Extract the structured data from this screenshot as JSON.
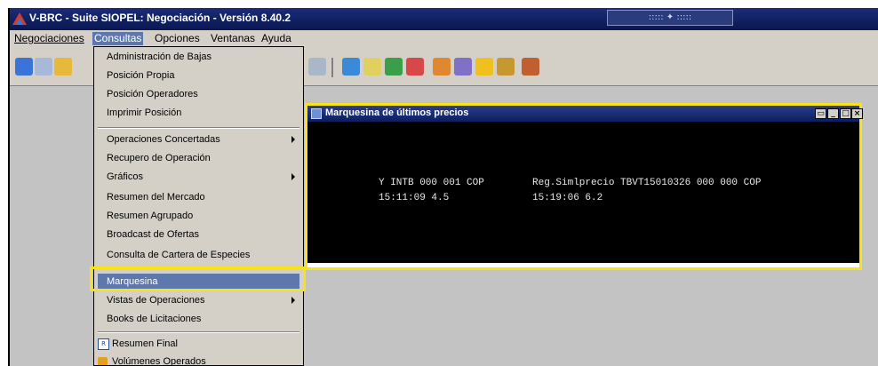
{
  "app": {
    "title": "V-BRC - Suite SIOPEL: Negociación - Versión 8.40.2"
  },
  "menubar": {
    "items": [
      {
        "label": "Negociaciones"
      },
      {
        "label": "Consultas"
      },
      {
        "label": "Opciones"
      },
      {
        "label": "Ventanas"
      },
      {
        "label": "Ayuda"
      }
    ]
  },
  "dropdown": {
    "items": [
      {
        "label": "Administración de Bajas"
      },
      {
        "label": "Posición Propia"
      },
      {
        "label": "Posición Operadores"
      },
      {
        "label": "Imprimir Posición"
      },
      {
        "label": "Operaciones Concertadas",
        "submenu": true
      },
      {
        "label": "Recupero de Operación"
      },
      {
        "label": "Gráficos",
        "submenu": true
      },
      {
        "label": "Resumen del Mercado"
      },
      {
        "label": "Resumen Agrupado"
      },
      {
        "label": "Broadcast de Ofertas"
      },
      {
        "label": "Consulta de Cartera de Especies"
      },
      {
        "label": "Marquesina",
        "selected": true
      },
      {
        "label": "Vistas de Operaciones",
        "submenu": true
      },
      {
        "label": "Books de Licitaciones"
      },
      {
        "label": "Resumen Final"
      },
      {
        "label": "Volúmenes Operados"
      }
    ]
  },
  "marquesina": {
    "title": "Marquesina de últimos precios",
    "quotes": [
      {
        "line1": "Y INTB 000 001 COP",
        "line2": "15:11:09 4.5"
      },
      {
        "line1": "Reg.Simlprecio TBVT15010326 000 000 COP",
        "line2": "15:19:06 6.2"
      }
    ]
  },
  "colors": {
    "highlight": "#f7e316",
    "selection": "#5e78ad",
    "titlebar": "#0a1750"
  }
}
